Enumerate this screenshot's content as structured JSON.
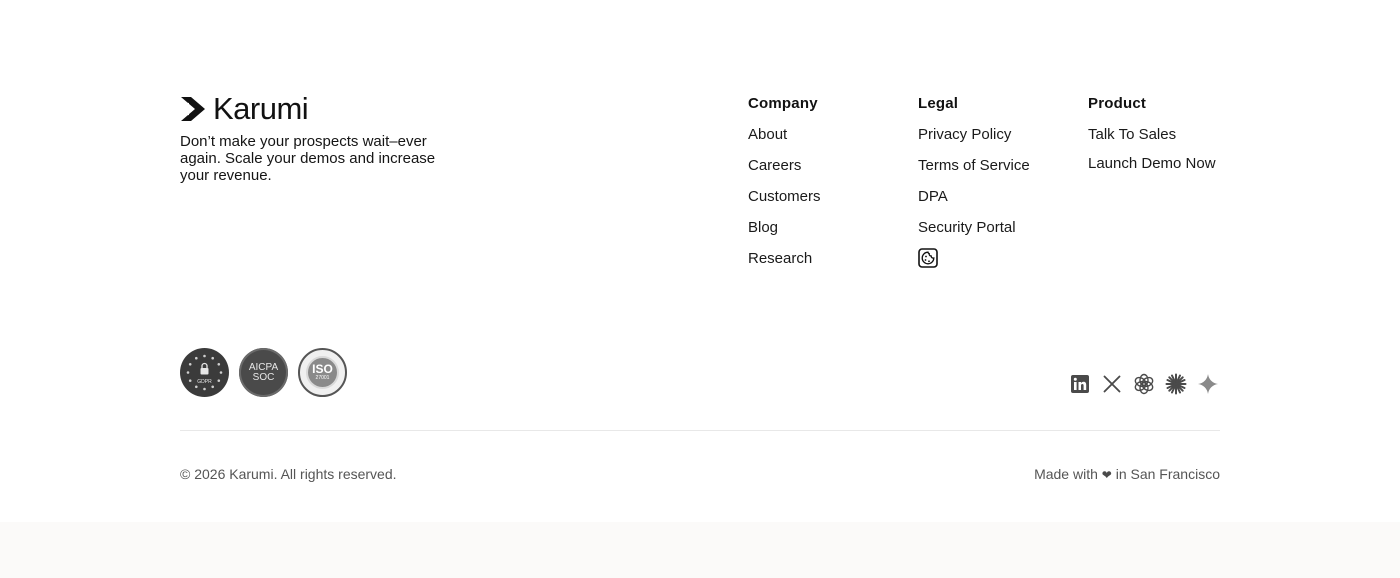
{
  "brand": {
    "name": "Karumi",
    "tagline": "Don’t make your prospects wait–ever again. Scale your demos and increase your revenue."
  },
  "columns": {
    "company": {
      "title": "Company",
      "links": [
        "About",
        "Careers",
        "Customers",
        "Blog",
        "Research"
      ]
    },
    "legal": {
      "title": "Legal",
      "links": [
        "Privacy Policy",
        "Terms of Service",
        "DPA",
        "Security Portal"
      ],
      "extra_icon": "cookie-settings-icon"
    },
    "product": {
      "title": "Product",
      "links": [
        "Talk To Sales",
        "Launch Demo Now"
      ]
    }
  },
  "badges": [
    {
      "name": "gdpr-badge",
      "text": "GDPR"
    },
    {
      "name": "aicpa-soc-badge",
      "text_top": "AICPA",
      "text_bottom": "SOC"
    },
    {
      "name": "iso-27001-badge",
      "text_top": "ISO",
      "text_bottom": "27001"
    }
  ],
  "socials": [
    "linkedin-icon",
    "x-twitter-icon",
    "openai-icon",
    "claude-icon",
    "gemini-icon"
  ],
  "footer": {
    "copyright": "© 2026 Karumi. All rights reserved.",
    "made_with_prefix": "Made with",
    "heart": "❤",
    "made_with_suffix": "in San Francisco"
  },
  "colors": {
    "text": "#141414",
    "muted": "#555555",
    "divider": "#e8e8e8",
    "bottom_band": "#fbfaf9"
  }
}
